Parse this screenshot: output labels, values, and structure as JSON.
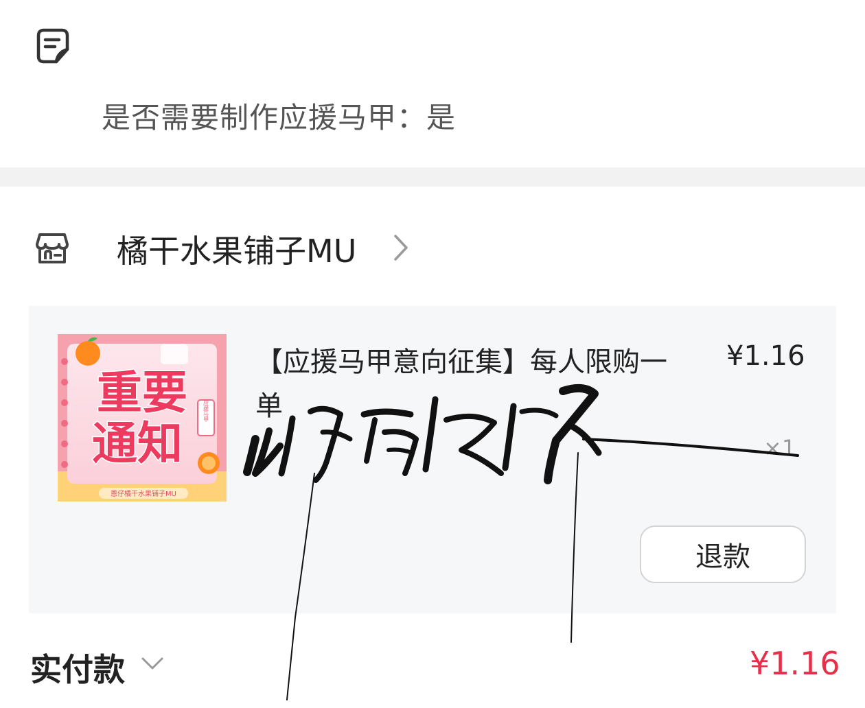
{
  "remark": {
    "icon": "remark-note-icon",
    "text": "是否需要制作应援马甲：是"
  },
  "store": {
    "icon": "store-icon",
    "name": "橘干水果铺子MU",
    "chevron_icon": "chevron-right-icon"
  },
  "product": {
    "thumbnail": {
      "headline_1": "重要",
      "headline_2": "通知",
      "tag": "应援马甲",
      "footer": "恩仔橘干水果铺子MU"
    },
    "title": "【应援马甲意向征集】每人限购一单",
    "price": "¥1.16",
    "quantity": "×1",
    "refund_label": "退款"
  },
  "payment": {
    "label": "实付款",
    "chevron_icon": "chevron-down-icon",
    "amount": "¥1.16"
  },
  "watermark": {
    "kind": "handwritten-signature"
  },
  "colors": {
    "accent_red": "#e5304a",
    "card_bg": "#f6f7f9",
    "divider": "#f2f2f2"
  }
}
